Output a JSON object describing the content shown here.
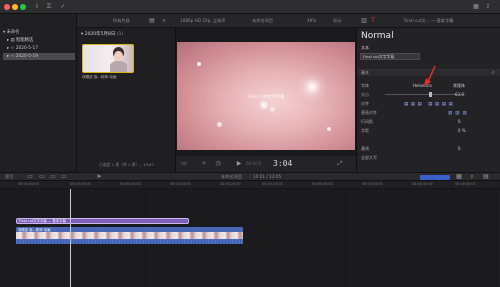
{
  "titlebar": {
    "library_label": "所有片段",
    "format_label": "1080p HD 25p, 立体声",
    "project_name": "未命名项目",
    "zoom": "49%",
    "view_label": "显示",
    "right_label": "Final cut文... — 基本字幕"
  },
  "library": {
    "items": [
      {
        "label": "未命名"
      },
      {
        "label": "智能精选"
      },
      {
        "label": "2020-5-17"
      },
      {
        "label": "2020-5-19"
      }
    ]
  },
  "browser": {
    "date_header": "2020年5月8日",
    "count": "(1)",
    "clip_label": "双眼皮 饭...粉饰 动画",
    "footer": "已选定 1 项（共 1 项），13:07"
  },
  "viewer": {
    "overlay_text": "Final cut文字字幕",
    "timecode": "3:04",
    "timecode_prefix": "00:00:0"
  },
  "inspector": {
    "title": "Normal",
    "text_section": "文本",
    "text_value": "Final cut文字字幕",
    "basic_section": "基本",
    "rows": [
      {
        "label": "字体",
        "value": "Helvetica",
        "extra": "常规体"
      },
      {
        "label": "大小",
        "value": "",
        "extra": "63.0"
      },
      {
        "label": "对齐",
        "value": "",
        "extra": ""
      },
      {
        "label": "垂直对齐",
        "value": "",
        "extra": ""
      },
      {
        "label": "行间距",
        "value": "",
        "extra": "0"
      },
      {
        "label": "字距",
        "value": "",
        "extra": "0 %"
      },
      {
        "label": "",
        "value": "",
        "extra": ""
      },
      {
        "label": "基线",
        "value": "",
        "extra": "0"
      },
      {
        "label": "全部大写",
        "value": "",
        "extra": ""
      }
    ]
  },
  "timeline": {
    "index_label": "索引",
    "project_label": "未命名项目",
    "position": "10:01 / 13:05",
    "ruler_labels": [
      "00:00:00:00",
      "00:00:05:00",
      "00:00:10:00",
      "00:00:15:00",
      "00:00:20:00",
      "00:00:25:00",
      "00:00:30:00",
      "00:00:35:00",
      "00:00:40:00",
      "00:00:45:00"
    ],
    "title_clip": "Final cut文字字幕 — 基本字幕",
    "video_clip": "双眼皮 饭...粉饰 动画"
  },
  "colors": {
    "accent_red": "#e0322a",
    "title_clip": "#7b5fb8",
    "video_clip": "#4a67b5",
    "selection": "#4a4a50"
  }
}
